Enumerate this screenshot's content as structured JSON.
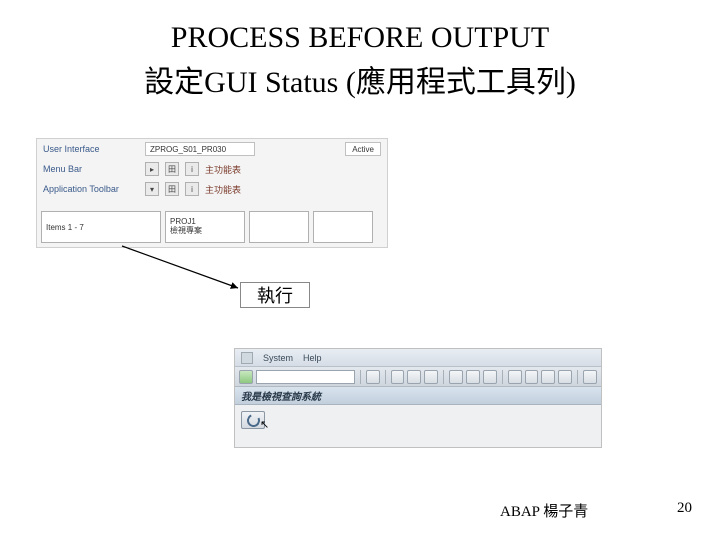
{
  "title_line1": "PROCESS BEFORE OUTPUT",
  "title_line2": "設定GUI Status (應用程式工具列)",
  "upper": {
    "user_interface_label": "User Interface",
    "user_interface_value": "ZPROG_S01_PR030",
    "status_value": "Active",
    "menu_bar_label": "Menu Bar",
    "menu_bar_cn": "主功能表",
    "app_toolbar_label": "Application Toolbar",
    "app_toolbar_cn": "主功能表",
    "items_label": "Items  1 - 7",
    "proj_code": "PROJ1",
    "proj_cn": "檢視專案"
  },
  "exec_label": "執行",
  "lower": {
    "menu": {
      "system": "System",
      "help": "Help"
    },
    "title_strip": "我是檢視查詢系統"
  },
  "footer": {
    "author": "ABAP 楊子青",
    "page": "20"
  }
}
